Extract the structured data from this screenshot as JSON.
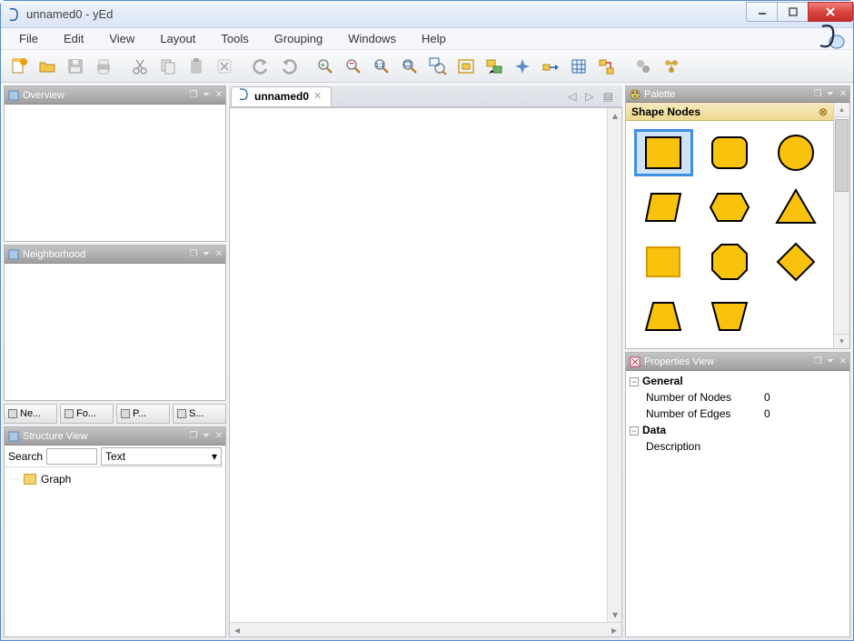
{
  "window": {
    "title": "unnamed0 - yEd"
  },
  "menu": {
    "items": [
      "File",
      "Edit",
      "View",
      "Layout",
      "Tools",
      "Grouping",
      "Windows",
      "Help"
    ]
  },
  "toolbar": {
    "icons": [
      "new-file-icon",
      "open-file-icon",
      "save-icon",
      "print-icon",
      "sep",
      "cut-icon",
      "copy-icon",
      "paste-icon",
      "delete-icon",
      "sep",
      "undo-icon",
      "redo-icon",
      "sep",
      "zoom-in-icon",
      "zoom-out-icon",
      "zoom-reset-icon",
      "zoom-area-icon",
      "zoom-fit-icon",
      "fit-selection-icon",
      "edit-mode-icon",
      "navigation-mode-icon",
      "snap-icon",
      "grid-icon",
      "orthogonal-icon",
      "sep",
      "previous-icon",
      "layout-apply-icon"
    ]
  },
  "left_panels": {
    "overview_title": "Overview",
    "neighborhood_title": "Neighborhood",
    "tabs": [
      "Ne...",
      "Fo...",
      "P...",
      "S..."
    ],
    "structure": {
      "title": "Structure View",
      "search_label": "Search",
      "combo_value": "Text",
      "root": "Graph"
    }
  },
  "document": {
    "tab_label": "unnamed0"
  },
  "palette": {
    "title": "Palette",
    "section": "Shape Nodes",
    "shapes": [
      "rectangle",
      "round-rectangle",
      "ellipse",
      "parallelogram",
      "hexagon",
      "triangle",
      "square-bevel",
      "octagon",
      "diamond",
      "trapezoid",
      "trapezoid-inverted"
    ]
  },
  "properties": {
    "title": "Properties View",
    "groups": {
      "general": {
        "label": "General",
        "nodes_label": "Number of Nodes",
        "nodes_value": "0",
        "edges_label": "Number of Edges",
        "edges_value": "0"
      },
      "data": {
        "label": "Data",
        "description_label": "Description"
      }
    }
  }
}
